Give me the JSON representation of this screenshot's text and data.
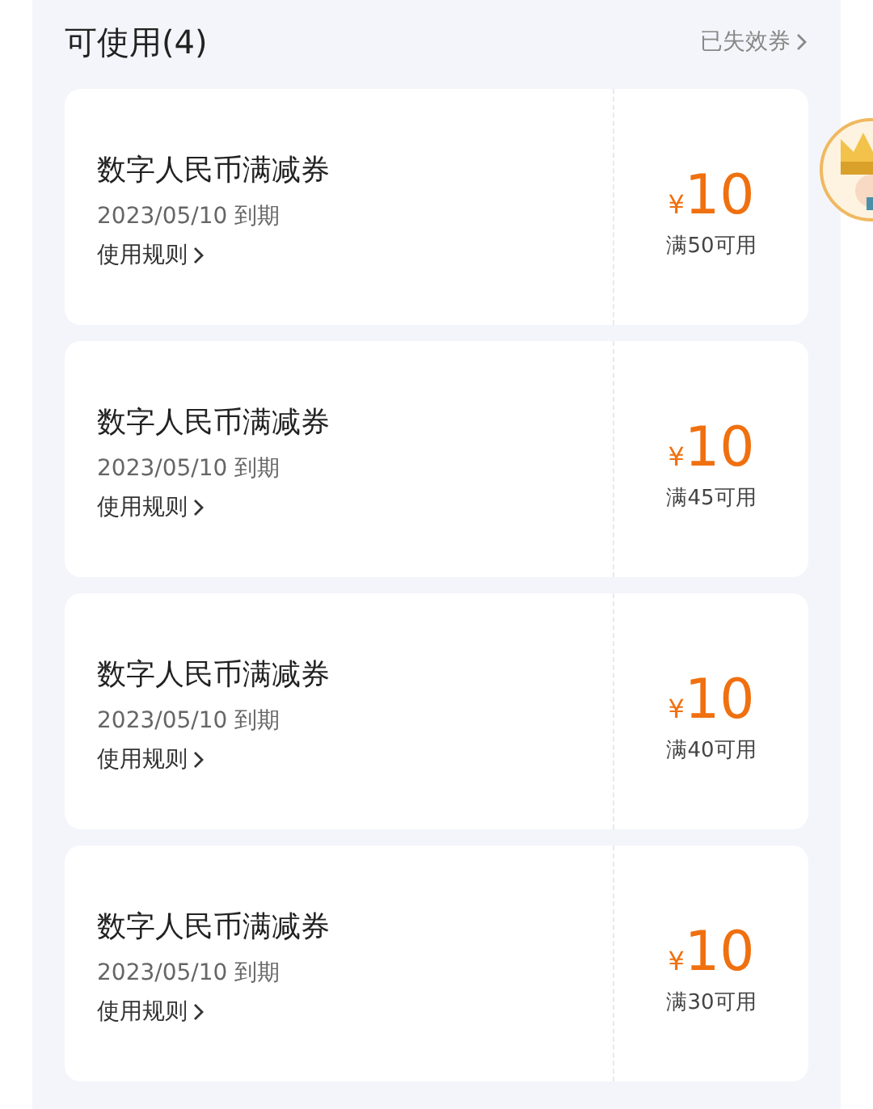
{
  "header": {
    "title": "可使用(4)",
    "link": "已失效券"
  },
  "coupons": [
    {
      "name": "数字人民币满减券",
      "expiry": "2023/05/10 到期",
      "rules": "使用规则",
      "currency": "¥",
      "amount": "10",
      "condition": "满50可用"
    },
    {
      "name": "数字人民币满减券",
      "expiry": "2023/05/10 到期",
      "rules": "使用规则",
      "currency": "¥",
      "amount": "10",
      "condition": "满45可用"
    },
    {
      "name": "数字人民币满减券",
      "expiry": "2023/05/10 到期",
      "rules": "使用规则",
      "currency": "¥",
      "amount": "10",
      "condition": "满40可用"
    },
    {
      "name": "数字人民币满减券",
      "expiry": "2023/05/10 到期",
      "rules": "使用规则",
      "currency": "¥",
      "amount": "10",
      "condition": "满30可用"
    }
  ]
}
